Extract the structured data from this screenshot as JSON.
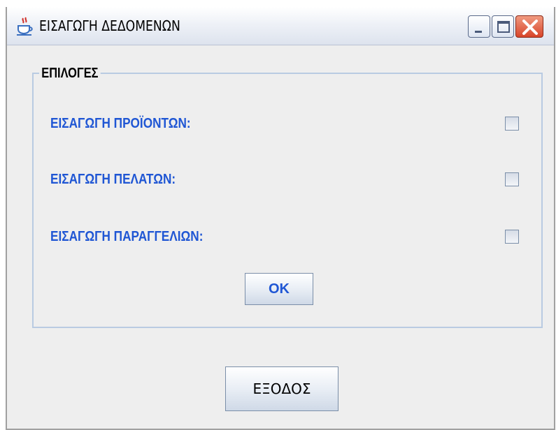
{
  "window": {
    "title": "ΕΙΣΑΓΩΓΗ ΔΕΔΟΜΕΝΩΝ",
    "app_icon": "java-cup-icon",
    "controls": {
      "minimize": "minimize-icon",
      "maximize": "maximize-icon",
      "close": "close-icon"
    }
  },
  "options_group": {
    "title": "ΕΠΙΛΟΓΕΣ",
    "items": [
      {
        "label": "ΕΙΣΑΓΩΓΗ ΠΡΟΪΟΝΤΩΝ:",
        "checked": false
      },
      {
        "label": "ΕΙΣΑΓΩΓΗ ΠΕΛΑΤΩΝ:",
        "checked": false
      },
      {
        "label": "ΕΙΣΑΓΩΓΗ ΠΑΡΑΓΓΕΛΙΩΝ:",
        "checked": false
      }
    ],
    "ok_label": "OK"
  },
  "exit_label": "ΕΞΟΔΟΣ",
  "colors": {
    "label_blue": "#1f56d4",
    "window_bg": "#eeeeee",
    "group_border": "#b9cbe2"
  }
}
